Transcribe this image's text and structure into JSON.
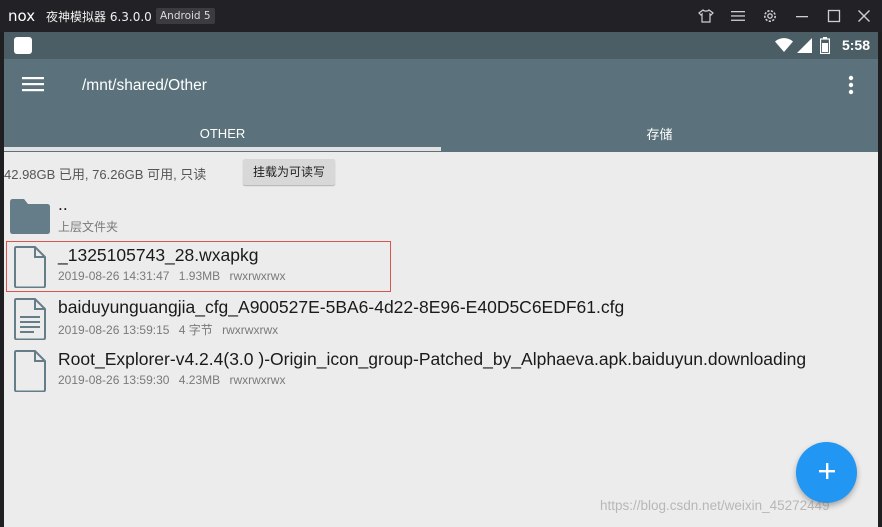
{
  "emulator": {
    "logo": "nox",
    "title": "夜神模拟器 6.3.0.0",
    "android_badge": "Android 5",
    "controls": [
      "shirt-icon",
      "menu-icon",
      "gear-icon",
      "minimize-icon",
      "maximize-icon",
      "close-icon"
    ]
  },
  "statusbar": {
    "time": "5:58",
    "icons": [
      "wifi-icon",
      "signal-icon",
      "battery-icon"
    ]
  },
  "appbar": {
    "path": "/mnt/shared/Other",
    "tabs": [
      {
        "label": "OTHER",
        "active": true
      },
      {
        "label": "存储",
        "active": false
      }
    ]
  },
  "storage": {
    "info": "42.98GB 已用, 76.26GB 可用, 只读",
    "button_label": "挂载为可读写"
  },
  "files": [
    {
      "name": "..",
      "meta": [
        "上层文件夹"
      ],
      "type": "folder"
    },
    {
      "name": "_1325105743_28.wxapkg",
      "meta": [
        "2019-08-26 14:31:47",
        "1.93MB",
        "rwxrwxrwx"
      ],
      "type": "file",
      "highlighted": true
    },
    {
      "name": "baiduyunguangjia_cfg_A900527E-5BA6-4d22-8E96-E40D5C6EDF61.cfg",
      "meta": [
        "2019-08-26 13:59:15",
        "4 字节",
        "rwxrwxrwx"
      ],
      "type": "text-file"
    },
    {
      "name": "Root_Explorer-v4.2.4(3.0 )-Origin_icon_group-Patched_by_Alphaeva.apk.baiduyun.downloading",
      "meta": [
        "2019-08-26 13:59:30",
        "4.23MB",
        "rwxrwxrwx"
      ],
      "type": "file"
    }
  ],
  "fab": {
    "icon": "plus-icon"
  },
  "watermark": "https://blog.csdn.net/weixin_45272449",
  "colors": {
    "appbar": "#5b727c",
    "statusbar": "#4b5e66",
    "fab": "#2196f3",
    "highlight_border": "#d9534f"
  }
}
